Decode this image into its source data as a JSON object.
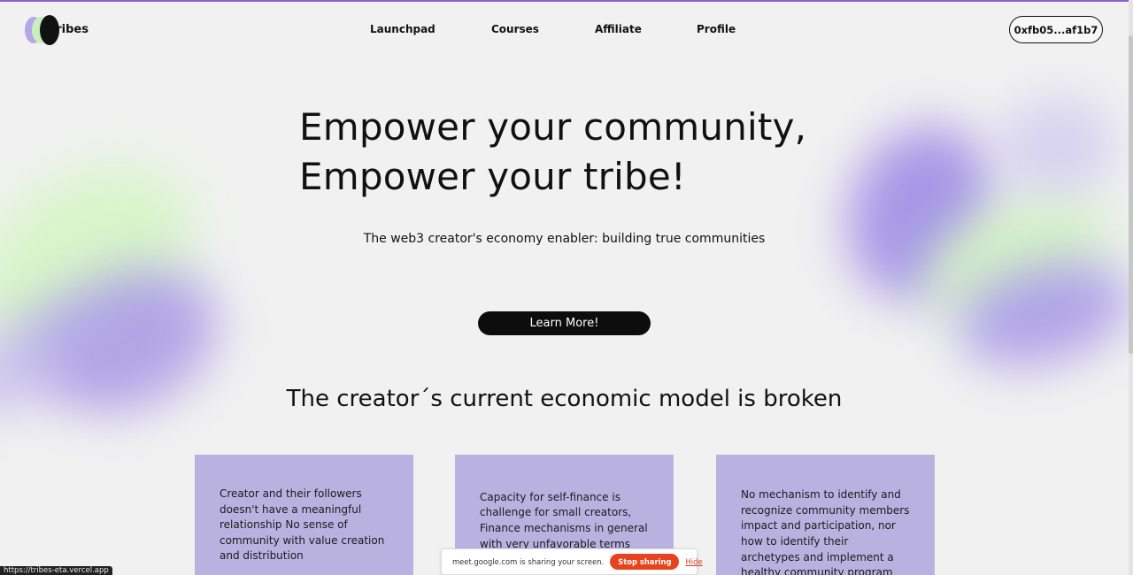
{
  "brand": {
    "name": "tribes"
  },
  "nav": {
    "items": [
      "Launchpad",
      "Courses",
      "Affiliate",
      "Profile"
    ]
  },
  "wallet": {
    "address": "0xfb05...af1b7"
  },
  "hero": {
    "title_line1": "Empower your community,",
    "title_line2": "Empower your tribe!",
    "subtitle": "The web3 creator's economy enabler: building true communities",
    "cta_label": "Learn More!"
  },
  "section": {
    "title": "The creator´s current economic model is broken"
  },
  "cards": [
    {
      "text": "Creator and their followers doesn't have a meaningful relationship No sense of community with value creation and distribution"
    },
    {
      "text": "Capacity for self-finance is challenge for small creators, Finance mechanisms in general with very unfavorable terms"
    },
    {
      "text": "No mechanism to identify and recognize community members impact and participation, nor how to identify their archetypes and implement a healthy community program"
    }
  ],
  "screen_share": {
    "message": "meet.google.com is sharing your screen.",
    "stop_label": "Stop sharing",
    "hide_label": "Hide"
  },
  "status_bar": {
    "url": "https://tribes-eta.vercel.app"
  },
  "colors": {
    "accent": "#8a5fcf",
    "card_bg": "#b9b2e0",
    "cta_bg": "#0d0d0d",
    "stop_bg": "#e8431e"
  }
}
